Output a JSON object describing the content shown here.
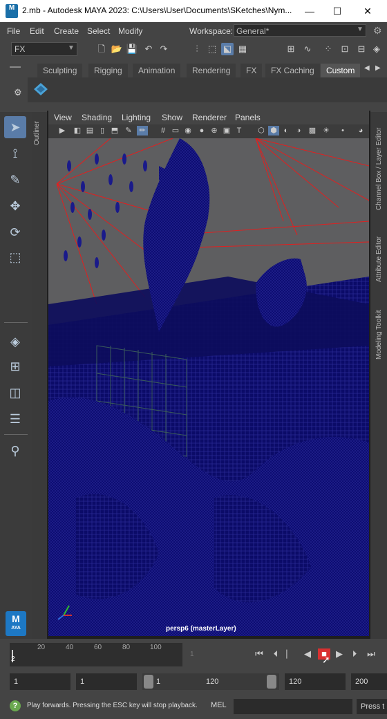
{
  "titlebar": {
    "app_icon": "M",
    "title": "2.mb - Autodesk MAYA 2023: C:\\Users\\User\\Documents\\SKetches\\Nym...",
    "min": "—",
    "max": "☐",
    "close": "✕"
  },
  "menubar": {
    "items": [
      "File",
      "Edit",
      "Create",
      "Select",
      "Modify"
    ],
    "workspace_label": "Workspace:",
    "workspace_value": "General*"
  },
  "statusline": {
    "menuset": "FX"
  },
  "shelf": {
    "tabs": [
      "Sculpting",
      "Rigging",
      "Animation",
      "Rendering",
      "FX",
      "FX Caching",
      "Custom"
    ],
    "active": "Custom"
  },
  "panel": {
    "menus": [
      "View",
      "Shading",
      "Lighting",
      "Show",
      "Renderer",
      "Panels"
    ],
    "camera_label": "persp6 (masterLayer)"
  },
  "sidepanels": {
    "outliner": "Outliner",
    "channel_box": "Channel Box / Layer Editor",
    "attribute_editor": "Attribute Editor",
    "modeling_toolkit": "Modeling Toolkit"
  },
  "timeslider": {
    "ticks": [
      "20",
      "40",
      "60",
      "80",
      "100",
      "1"
    ],
    "current_frame": "2"
  },
  "rangeslider": {
    "start": "1",
    "playback_start": "1",
    "range_start": "1",
    "range_end": "120",
    "playback_end": "120",
    "end": "200"
  },
  "helpline": {
    "message": "Play forwards. Pressing the ESC key will stop playback.",
    "cmd_label": "MEL",
    "result": "Press t"
  },
  "logo": {
    "text": "M",
    "sub": "AYA"
  },
  "colors": {
    "viewport_bg": "#5e5e60",
    "wire": "#0b0b6e",
    "light": "#e02020",
    "accent": "#5a7ca8",
    "play_active": "#d93030"
  }
}
